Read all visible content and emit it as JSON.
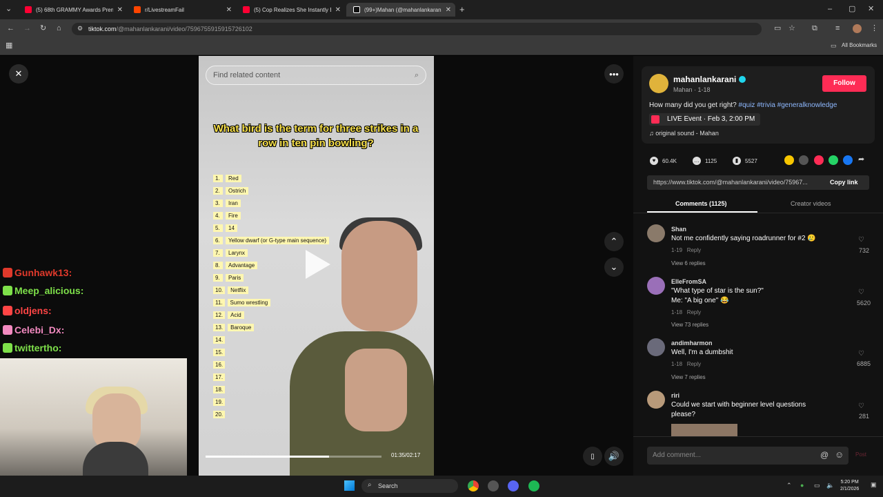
{
  "browser": {
    "tabs": [
      {
        "title": "(5) 68th GRAMMY Awards Prem",
        "color": "#ff0033"
      },
      {
        "title": "r/LivestreamFail",
        "color": "#ff4500"
      },
      {
        "title": "(5) Cop Realizes She Instantly E",
        "color": "#ff0033"
      },
      {
        "title": "(99+)Mahan (@mahanlankarani",
        "color": "#222222"
      }
    ],
    "new_tab": "+",
    "url_domain": "tiktok.com",
    "url_path": "/@mahanlankarani/video/7596755915915726102",
    "bookmarks_label": "All Bookmarks"
  },
  "video": {
    "search_placeholder": "Find related content",
    "question": "What bird is the term for three strikes in a row in ten pin bowling?",
    "answers": [
      {
        "n": "1.",
        "t": "Red"
      },
      {
        "n": "2.",
        "t": "Ostrich"
      },
      {
        "n": "3.",
        "t": "Iran"
      },
      {
        "n": "4.",
        "t": "Fire"
      },
      {
        "n": "5.",
        "t": "14"
      },
      {
        "n": "6.",
        "t": "Yellow dwarf (or G-type main sequence)"
      },
      {
        "n": "7.",
        "t": "Larynx"
      },
      {
        "n": "8.",
        "t": "Advantage"
      },
      {
        "n": "9.",
        "t": "Paris"
      },
      {
        "n": "10.",
        "t": "Netflix"
      },
      {
        "n": "11.",
        "t": "Sumo wrestling"
      },
      {
        "n": "12.",
        "t": "Acid"
      },
      {
        "n": "13.",
        "t": "Baroque"
      },
      {
        "n": "14.",
        "t": ""
      },
      {
        "n": "15.",
        "t": ""
      },
      {
        "n": "16.",
        "t": ""
      },
      {
        "n": "17.",
        "t": ""
      },
      {
        "n": "18.",
        "t": ""
      },
      {
        "n": "19.",
        "t": ""
      },
      {
        "n": "20.",
        "t": ""
      }
    ],
    "time": "01:35/02:17",
    "progress": 0.7
  },
  "chat": [
    {
      "user": "Gunhawk13:",
      "color": "#e0392b"
    },
    {
      "user": "Meep_alicious:",
      "color": "#7ee04a"
    },
    {
      "user": "oldjens:",
      "color": "#ff4545"
    },
    {
      "user": "Celebi_Dx:",
      "color": "#f28ac0"
    },
    {
      "user": "twittertho:",
      "color": "#7ee04a"
    }
  ],
  "profile": {
    "username": "mahanlankarani",
    "display": "Mahan · 1-18",
    "follow": "Follow",
    "caption": "How many did you get right?",
    "tags": [
      "#quiz",
      "#trivia",
      "#generalknowledge"
    ],
    "live_event": "LIVE Event · Feb 3, 2:00 PM",
    "sound": "original sound - Mahan",
    "likes": "60.4K",
    "comments_count": "1125",
    "saves": "5527",
    "link": "https://www.tiktok.com/@mahanlankarani/video/75967...",
    "copy_link": "Copy link",
    "tab_comments": "Comments (1125)",
    "tab_creator": "Creator videos"
  },
  "comments": [
    {
      "author": "Shan",
      "text": "Not me confidently saying roadrunner for #2 🥲",
      "date": "1-19",
      "reply": "Reply",
      "view": "View 6 replies",
      "likes": "732",
      "avatar": "#8a7a6a"
    },
    {
      "author": "ElleFromSA",
      "text": "\"What type of star is the sun?\"",
      "text2": "Me: \"A big one\" 😂",
      "date": "1-18",
      "reply": "Reply",
      "view": "View 73 replies",
      "likes": "5620",
      "avatar": "#9a6fb8"
    },
    {
      "author": "andimharmon",
      "text": "Well, I'm a dumbshit",
      "date": "1-18",
      "reply": "Reply",
      "view": "View 7 replies",
      "likes": "6885",
      "avatar": "#6a6a7a"
    },
    {
      "author": "riri",
      "text": "Could we start with beginner level questions",
      "text2": "please?",
      "likes": "281",
      "avatar": "#b89a7a"
    }
  ],
  "comment_input": {
    "placeholder": "Add comment...",
    "post": "Post",
    "at": "@",
    "emoji": "☺"
  },
  "taskbar": {
    "search": "Search",
    "time": "5:20 PM",
    "date": "2/1/2026"
  }
}
